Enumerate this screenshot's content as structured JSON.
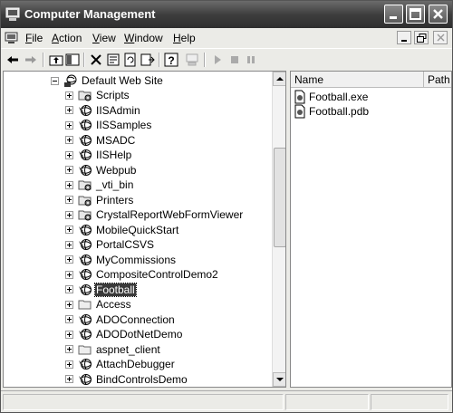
{
  "window": {
    "title": "Computer Management"
  },
  "menu": [
    {
      "label": "File",
      "accel": "F",
      "rest": "ile"
    },
    {
      "label": "Action",
      "accel": "A",
      "rest": "ction"
    },
    {
      "label": "View",
      "accel": "V",
      "rest": "iew"
    },
    {
      "label": "Window",
      "accel": "W",
      "rest": "indow"
    },
    {
      "label": "Help",
      "accel": "H",
      "rest": "elp"
    }
  ],
  "tree": {
    "root": {
      "label": "Default Web Site",
      "icon": "website-globe-icon",
      "expander": "minus"
    },
    "items": [
      {
        "label": "Scripts",
        "icon": "folder-gear-icon"
      },
      {
        "label": "IISAdmin",
        "icon": "web-app-icon"
      },
      {
        "label": "IISSamples",
        "icon": "web-app-icon"
      },
      {
        "label": "MSADC",
        "icon": "web-app-icon"
      },
      {
        "label": "IISHelp",
        "icon": "web-app-icon"
      },
      {
        "label": "Webpub",
        "icon": "web-app-icon"
      },
      {
        "label": "_vti_bin",
        "icon": "folder-gear-icon"
      },
      {
        "label": "Printers",
        "icon": "folder-gear-icon"
      },
      {
        "label": "CrystalReportWebFormViewer",
        "icon": "folder-gear-icon"
      },
      {
        "label": "MobileQuickStart",
        "icon": "web-app-icon"
      },
      {
        "label": "PortalCSVS",
        "icon": "web-app-icon"
      },
      {
        "label": "MyCommissions",
        "icon": "web-app-icon"
      },
      {
        "label": "CompositeControlDemo2",
        "icon": "web-app-icon"
      },
      {
        "label": "Football",
        "icon": "web-app-icon",
        "selected": true
      },
      {
        "label": "Access",
        "icon": "folder-icon"
      },
      {
        "label": "ADOConnection",
        "icon": "web-app-icon"
      },
      {
        "label": "ADODotNetDemo",
        "icon": "web-app-icon"
      },
      {
        "label": "aspnet_client",
        "icon": "folder-icon"
      },
      {
        "label": "AttachDebugger",
        "icon": "web-app-icon"
      },
      {
        "label": "BindControlsDemo",
        "icon": "web-app-icon"
      }
    ]
  },
  "list": {
    "columns": [
      "Name",
      "Path"
    ],
    "files": [
      {
        "name": "Football.exe",
        "icon": "file-icon"
      },
      {
        "name": "Football.pdb",
        "icon": "file-icon"
      }
    ]
  }
}
